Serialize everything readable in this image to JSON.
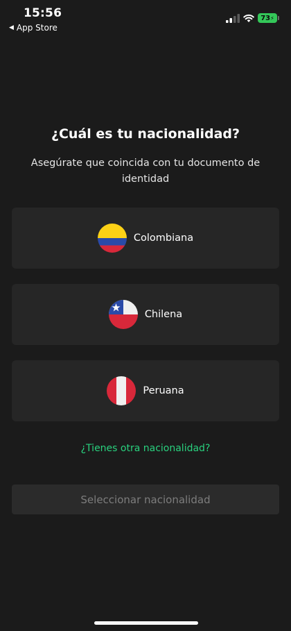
{
  "status_bar": {
    "time": "15:56",
    "back_label": "App Store",
    "battery": "73"
  },
  "screen": {
    "title": "¿Cuál es tu nacionalidad?",
    "subtitle": "Asegúrate que coincida con tu documento de identidad"
  },
  "options": [
    {
      "label": "Colombiana",
      "icon": "colombia-flag-icon"
    },
    {
      "label": "Chilena",
      "icon": "chile-flag-icon"
    },
    {
      "label": "Peruana",
      "icon": "peru-flag-icon"
    }
  ],
  "other_link": "¿Tienes otra nacionalidad?",
  "select_button": "Seleccionar nacionalidad",
  "colors": {
    "background": "#1b1b1b",
    "card": "#262626",
    "link_green": "#29d17e",
    "battery_green": "#34c759",
    "button_disabled_text": "#7d7d7d"
  }
}
